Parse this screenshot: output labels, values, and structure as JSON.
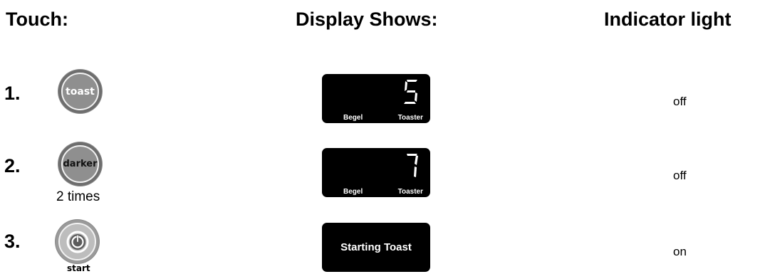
{
  "headers": {
    "touch": "Touch:",
    "display": "Display Shows:",
    "indicator": "Indicator light"
  },
  "steps": [
    {
      "number": "1.",
      "button_label": "toast",
      "button_icon": "toast-button-icon",
      "display_value": "5",
      "display_left": "Begel",
      "display_right": "Toaster",
      "indicator": "off"
    },
    {
      "number": "2.",
      "button_label": "darker",
      "button_icon": "darker-button-icon",
      "button_note": "2 times",
      "display_value": "7",
      "display_left": "Begel",
      "display_right": "Toaster",
      "indicator": "off"
    },
    {
      "number": "3.",
      "button_label": "start",
      "button_icon": "power-icon",
      "display_message": "Starting Toast",
      "indicator": "on"
    }
  ],
  "colors": {
    "display_bg": "#000000",
    "button_grey": "#8f8f8f"
  }
}
